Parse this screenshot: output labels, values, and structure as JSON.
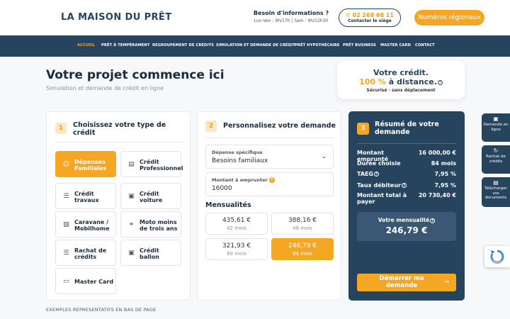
{
  "header": {
    "logo": "LA MAISON DU PRÊT",
    "info_title": "Besoin d'informations ?",
    "info_hours": "Lun-Ven : 9h/17h | Sam : 9h/12h30",
    "phone": "02 268 68 11",
    "phone_sub": "Contacter le siège",
    "regional_label": "Numéros régionaux"
  },
  "nav": {
    "items": [
      "ACCUEIL",
      "PRÊT À TEMPÉRAMENT",
      "REGROUPEMENT DE CRÉDITS",
      "SIMULATION ET DEMANDE DE CRÉDIT",
      "PRÊT HYPOTHÉCAIRE",
      "PRÊT BUSINESS",
      "MASTER CARD",
      "CONTACT"
    ],
    "active": "ACCUEIL"
  },
  "hero": {
    "title": "Votre projet commence ici",
    "subtitle": "Simulation et demande de crédit en ligne"
  },
  "promo": {
    "line1": "Votre crédit.",
    "line2_accent": "100 %",
    "line2_rest": " à distance.",
    "line3": "Sécurisé - sans déplacement"
  },
  "step1": {
    "num": "1",
    "title": "Choisissez votre type de crédit",
    "options": [
      {
        "label": "Dépenses Familiales",
        "icon": "family-icon",
        "selected": true
      },
      {
        "label": "Crédit Professionnel",
        "icon": "briefcase-icon",
        "selected": false
      },
      {
        "label": "Crédit travaux",
        "icon": "layers-icon",
        "selected": false
      },
      {
        "label": "Crédit voiture",
        "icon": "car-icon",
        "selected": false
      },
      {
        "label": "Caravane / Mobilhome",
        "icon": "caravan-icon",
        "selected": false
      },
      {
        "label": "Moto moins de trois ans",
        "icon": "motorbike-icon",
        "selected": false
      },
      {
        "label": "Rachat de crédits",
        "icon": "layers-icon",
        "selected": false
      },
      {
        "label": "Crédit ballon",
        "icon": "van-icon",
        "selected": false
      },
      {
        "label": "Master Card",
        "icon": "credit-card-icon",
        "selected": false
      }
    ]
  },
  "step2": {
    "num": "2",
    "title": "Personnalisez votre demande",
    "expense_label": "Dépense spécifique",
    "expense_value": "Besoins familiaux",
    "amount_label": "Montant à emprunter",
    "amount_value": "16000",
    "mens_title": "Mensualités",
    "monthly_options": [
      {
        "amount": "435,61 €",
        "duration": "42 mois",
        "selected": false
      },
      {
        "amount": "388,16 €",
        "duration": "48 mois",
        "selected": false
      },
      {
        "amount": "321,93 €",
        "duration": "60 mois",
        "selected": false
      },
      {
        "amount": "246,79 €",
        "duration": "84 mois",
        "selected": true
      }
    ]
  },
  "summary": {
    "num": "3",
    "title": "Résumé de votre demande",
    "rows": [
      {
        "label": "Montant emprunté",
        "value": "16 000,00 €",
        "help": false
      },
      {
        "label": "Durée choisie",
        "value": "84 mois",
        "help": false
      },
      {
        "label": "TAEG",
        "value": "7,95 %",
        "help": true
      },
      {
        "label": "Taux débiteur",
        "value": "7,95 %",
        "help": true
      },
      {
        "label": "Montant total à payer",
        "value": "20 730,40 €",
        "help": false
      }
    ],
    "monthly_label": "Votre mensualité",
    "monthly_value": "246,79 €",
    "start_label": "Démarrer ma demande"
  },
  "footer_note": "EXEMPLES REPRESENTATIFS EN BAS DE PAGE",
  "side_tabs": [
    {
      "label": "Demande en ligne",
      "icon": "monitor-icon"
    },
    {
      "label": "Rachat de crédits",
      "icon": "refresh-icon"
    },
    {
      "label": "Télécharger vos documents",
      "icon": "document-icon"
    }
  ],
  "colors": {
    "primary": "#27445e",
    "accent": "#f5a623"
  }
}
